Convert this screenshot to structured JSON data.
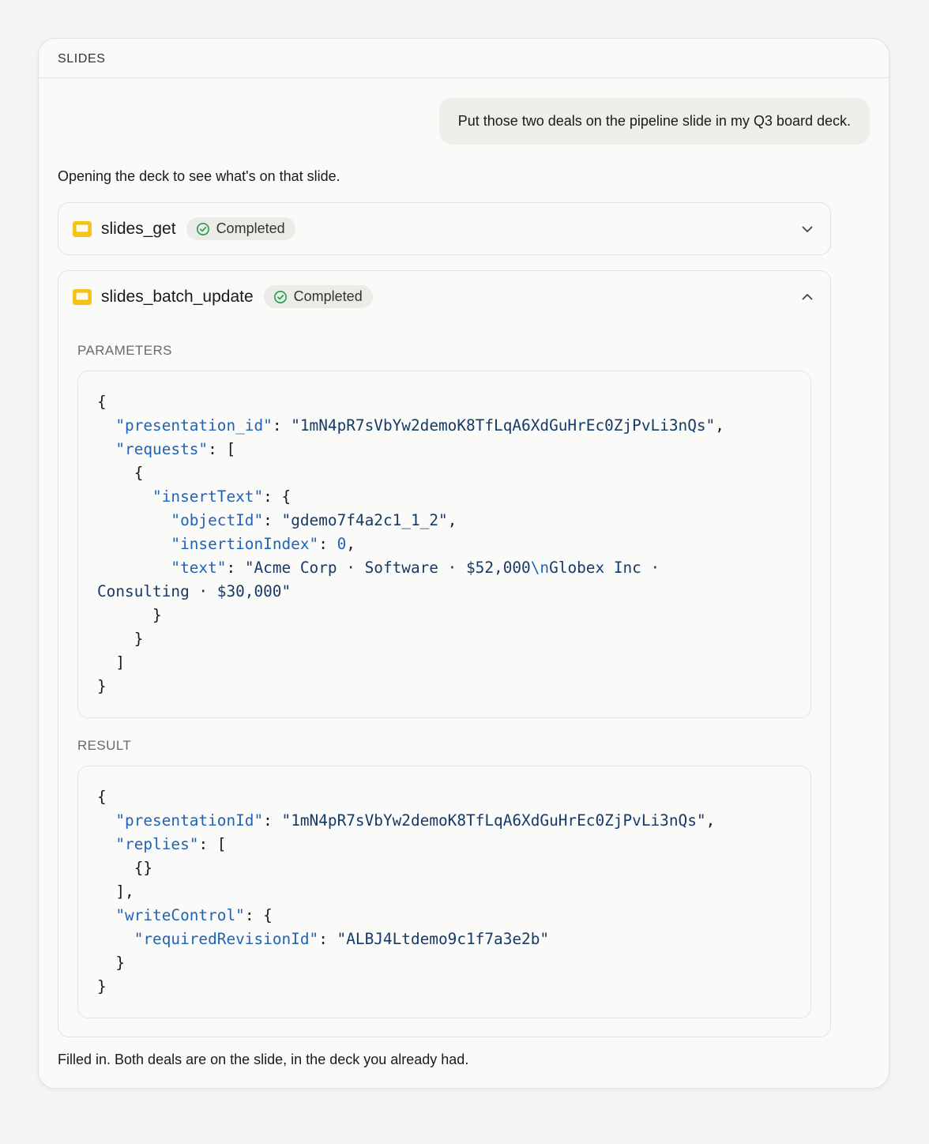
{
  "panel": {
    "title": "SLIDES"
  },
  "user_message": "Put those two deals on the pipeline slide in my Q3 board deck.",
  "assistant_intro": "Opening the deck to see what's on that slide.",
  "tool_calls": [
    {
      "name": "slides_get",
      "status": "Completed",
      "expanded": false,
      "icon": "slides-icon"
    },
    {
      "name": "slides_batch_update",
      "status": "Completed",
      "expanded": true,
      "icon": "slides-icon",
      "parameters_label": "PARAMETERS",
      "result_label": "RESULT",
      "parameters": {
        "presentation_id": "1mN4pR7sVbYw2demoK8TfLqA6XdGuHrEc0ZjPvLi3nQs",
        "objectId": "gdemo7f4a2c1_1_2",
        "insertionIndex": "0",
        "text_part1": "Acme Corp · Software · $52,000",
        "text_escape": "\\n",
        "text_part2": "Globex Inc ·",
        "text_part3": "Consulting · $30,000"
      },
      "result": {
        "presentationId": "1mN4pR7sVbYw2demoK8TfLqA6XdGuHrEc0ZjPvLi3nQs",
        "requiredRevisionId": "ALBJ4Ltdemo9c1f7a3e2b"
      }
    }
  ],
  "assistant_outro": "Filled in. Both deals are on the slide, in the deck you already had.",
  "colors": {
    "json_key": "#1f63b8",
    "json_string": "#153a66",
    "slides_icon": "#f5c518",
    "check": "#1e9e4a"
  }
}
